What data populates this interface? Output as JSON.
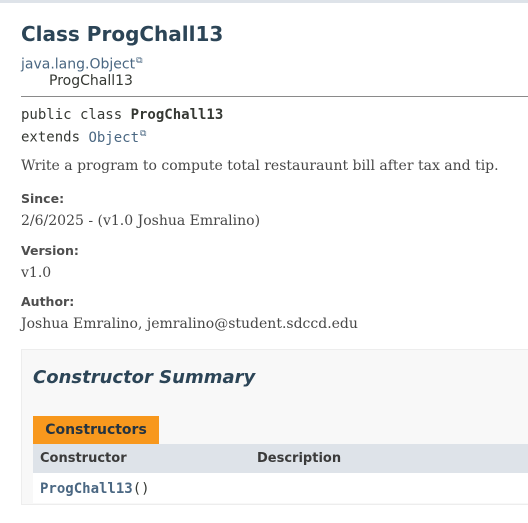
{
  "header": {
    "class_title": "Class ProgChall13"
  },
  "inheritance": {
    "parent_link": "java.lang.Object",
    "child": "ProgChall13"
  },
  "signature": {
    "prefix": "public class ",
    "class_name": "ProgChall13",
    "extends_keyword": "extends ",
    "extends_link": "Object"
  },
  "description": "Write a program to compute total restauraunt bill after tax and tip.",
  "details": {
    "since_label": "Since:",
    "since_value": "2/6/2025 - (v1.0 Joshua Emralino)",
    "version_label": "Version:",
    "version_value": "v1.0",
    "author_label": "Author:",
    "author_value": "Joshua Emralino, jemralino@student.sdccd.edu"
  },
  "constructor_summary": {
    "title": "Constructor Summary",
    "tab_label": "Constructors",
    "columns": [
      "Constructor",
      "Description"
    ],
    "rows": [
      {
        "constructor": "ProgChall13",
        "params": "()",
        "description": ""
      }
    ]
  },
  "icons": {
    "external_link": "external-link-icon"
  },
  "colors": {
    "title": "#2c4557",
    "link": "#4a6782",
    "tab": "#f8981d",
    "table_header": "#dee3e9"
  }
}
